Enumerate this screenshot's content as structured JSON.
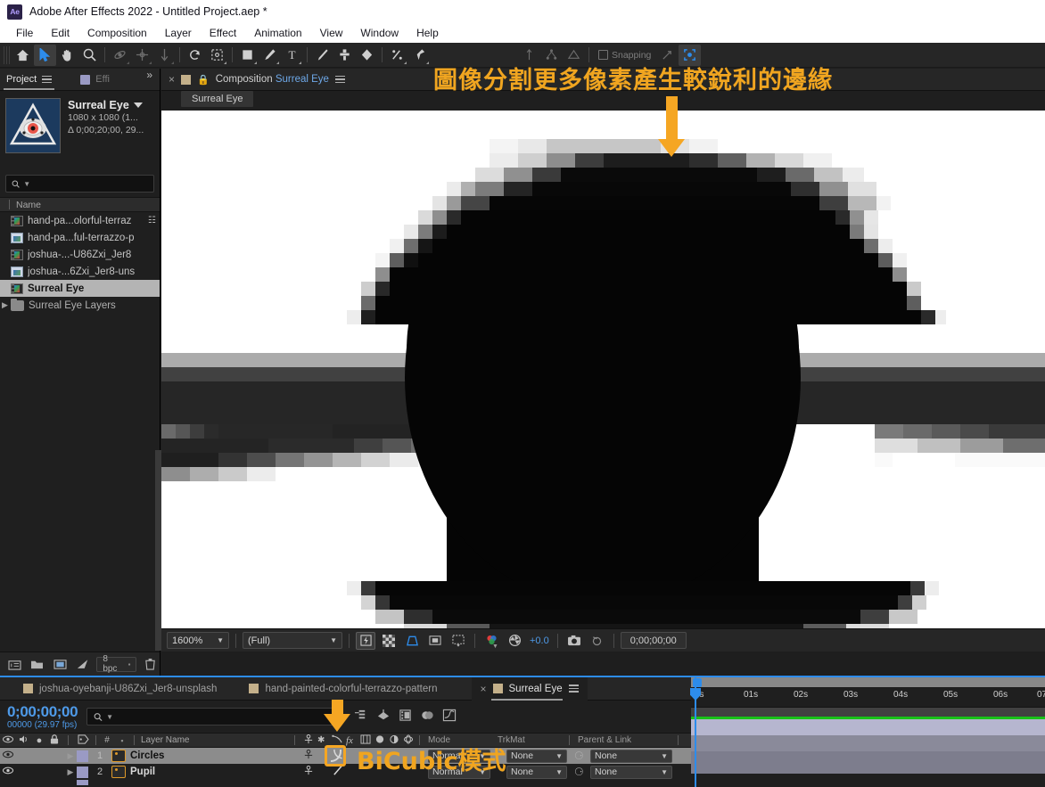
{
  "window": {
    "app_logo": "Ae",
    "title": "Adobe After Effects 2022 - Untitled Project.aep *"
  },
  "menubar": {
    "items": [
      "File",
      "Edit",
      "Composition",
      "Layer",
      "Effect",
      "Animation",
      "View",
      "Window",
      "Help"
    ]
  },
  "toolbar": {
    "snapping_label": "Snapping",
    "tools": [
      {
        "name": "home-icon",
        "active": false
      },
      {
        "name": "selection-tool-icon",
        "active": true
      },
      {
        "name": "hand-tool-icon",
        "active": false
      },
      {
        "name": "zoom-tool-icon",
        "active": false
      },
      {
        "name": "orbit-tool-icon",
        "active": false,
        "dim": true
      },
      {
        "name": "pan-tool-icon",
        "active": false,
        "dim": true
      },
      {
        "name": "dolly-tool-icon",
        "active": false,
        "dim": true
      },
      {
        "name": "rotation-tool-icon",
        "active": false
      },
      {
        "name": "anchor-point-tool-icon",
        "active": false
      },
      {
        "name": "shape-tool-icon",
        "active": false
      },
      {
        "name": "pen-tool-icon",
        "active": false
      },
      {
        "name": "type-tool-icon",
        "active": false
      },
      {
        "name": "brush-tool-icon",
        "active": false
      },
      {
        "name": "clone-stamp-tool-icon",
        "active": false
      },
      {
        "name": "eraser-tool-icon",
        "active": false
      },
      {
        "name": "roto-brush-tool-icon",
        "active": false
      },
      {
        "name": "puppet-pin-tool-icon",
        "active": false
      }
    ]
  },
  "project_panel": {
    "tabs": [
      {
        "label": "Project",
        "selected": true,
        "name": "tab-project"
      },
      {
        "label": "Effi",
        "selected": false,
        "name": "tab-effects"
      }
    ],
    "overflow_label": "»",
    "item_title": "Surreal Eye",
    "item_dimensions": "1080 x 1080 (1...",
    "item_duration": "Δ 0;00;20;00, 29...",
    "search_placeholder": "",
    "column_header": "Name",
    "files": [
      {
        "label": "hand-pa...olorful-terraz",
        "icon": "composition-icon",
        "selected": false,
        "has_network": true
      },
      {
        "label": "hand-pa...ful-terrazzo-p",
        "icon": "image-icon",
        "selected": false,
        "has_network": false
      },
      {
        "label": "joshua-...-U86Zxi_Jer8",
        "icon": "composition-icon",
        "selected": false,
        "has_network": false
      },
      {
        "label": "joshua-...6Zxi_Jer8-uns",
        "icon": "image-icon",
        "selected": false,
        "has_network": false
      },
      {
        "label": "Surreal Eye",
        "icon": "composition-icon",
        "selected": true,
        "has_network": false
      },
      {
        "label": "Surreal Eye Layers",
        "icon": "folder-icon",
        "selected": false,
        "has_network": false,
        "expandable": true
      }
    ],
    "footer": {
      "bit_depth": "8 bpc",
      "icons": [
        "new-folder-icon",
        "new-composition-icon",
        "project-settings-icon",
        "delete-icon"
      ]
    }
  },
  "viewer": {
    "close_label": "×",
    "lock_icon": "lock-icon",
    "title_prefix": "Composition",
    "title_name": "Surreal Eye",
    "menu_icon": "panel-menu-icon",
    "subtab_label": "Surreal Eye",
    "bottom_bar": {
      "zoom": "1600%",
      "resolution": "(Full)",
      "exposure": "+0.0",
      "timecode": "0;00;00;00",
      "icons": [
        "fast-previews-icon",
        "transparency-grid-icon",
        "region-of-interest-icon",
        "mask-outlines-icon",
        "grid-guides-icon",
        "channel-icon",
        "exposure-icon",
        "snapshot-icon",
        "show-snapshot-icon"
      ]
    }
  },
  "timeline": {
    "tabs": [
      {
        "label": "joshua-oyebanji-U86Zxi_Jer8-unsplash",
        "active": false
      },
      {
        "label": "hand-painted-colorful-terrazzo-pattern",
        "active": false
      },
      {
        "label": "Surreal Eye",
        "active": true
      }
    ],
    "current_time": "0;00;00;00",
    "frame_info": "00000 (29.97 fps)",
    "search_placeholder": "",
    "columns": {
      "layer_name": "Layer Name",
      "mode": "Mode",
      "track_matte": "TrkMat",
      "parent_link": "Parent & Link",
      "hash": "#",
      "toggles": [
        "eye-icon",
        "audio-icon",
        "solo-icon",
        "lock-icon"
      ],
      "switches": [
        "shy-icon",
        "collapse-transformations-icon",
        "quality-icon",
        "effects-icon",
        "frame-blending-icon",
        "motion-blur-icon",
        "adjustment-layer-icon",
        "3d-layer-icon"
      ]
    },
    "layers": [
      {
        "index": "1",
        "name": "Circles",
        "selected": true,
        "mode": "Normal",
        "track_matte": "None",
        "parent": "None",
        "quality": "bicubic"
      },
      {
        "index": "2",
        "name": "Pupil",
        "selected": false,
        "mode": "Normal",
        "track_matte": "None",
        "parent": "None",
        "quality": "bilinear"
      }
    ],
    "ruler_ticks": [
      "0s",
      "01s",
      "02s",
      "03s",
      "04s",
      "05s",
      "06s",
      "07"
    ]
  },
  "annotations": {
    "top_text": "圖像分割更多像素產生較銳利的邊緣",
    "bottom_text": "BiCubic模式",
    "color": "#f5a623"
  },
  "colors": {
    "accent_blue": "#2d8ceb",
    "annotation_orange": "#f5a623",
    "panel_bg": "#1f1f1f",
    "toolbar_bg": "#262626",
    "selection_grey": "#8c8c8c"
  }
}
